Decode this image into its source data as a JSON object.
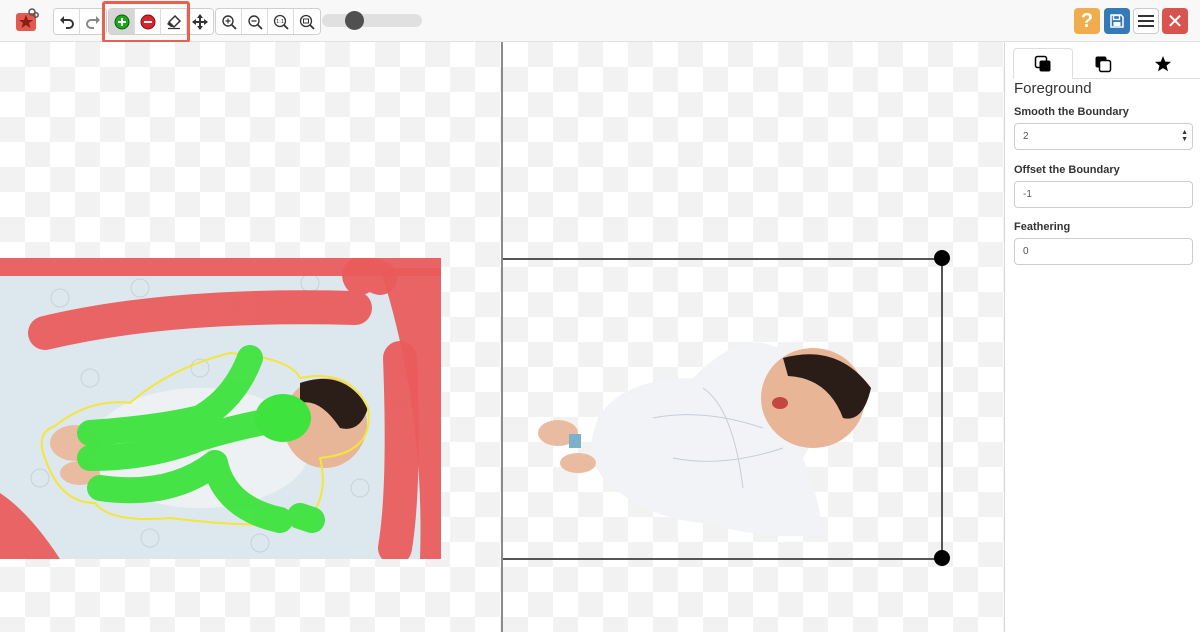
{
  "toolbar": {
    "undo_icon": "undo-icon",
    "redo_icon": "redo-icon",
    "tools": [
      "add-foreground-icon",
      "add-background-icon",
      "eraser-icon",
      "move-icon"
    ],
    "zoom": [
      "zoom-in-icon",
      "zoom-out-icon",
      "zoom-actual-icon",
      "zoom-fit-icon"
    ],
    "right_buttons": {
      "help": "?",
      "close": "✕"
    },
    "colors": {
      "help": "#f0ad4e",
      "save": "#337ab7",
      "close": "#d9534f",
      "highlight": "#e8604f"
    }
  },
  "sidebar": {
    "tabs": [
      "foreground-tab-icon",
      "background-tab-icon",
      "star-tab-icon"
    ],
    "title": "Foreground",
    "smooth": {
      "label": "Smooth the Boundary",
      "value": "2"
    },
    "offset": {
      "label": "Offset the Boundary",
      "value": "-1"
    },
    "feathering": {
      "label": "Feathering",
      "value": "0"
    }
  }
}
